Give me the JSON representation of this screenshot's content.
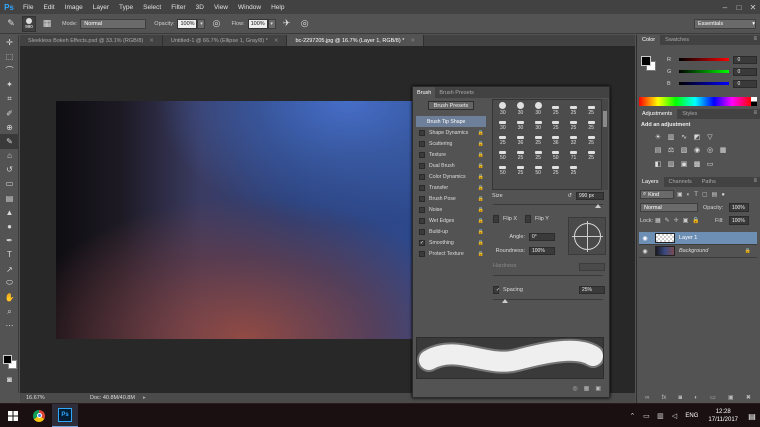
{
  "app": {
    "logo": "Ps"
  },
  "menu": [
    "File",
    "Edit",
    "Image",
    "Layer",
    "Type",
    "Select",
    "Filter",
    "3D",
    "View",
    "Window",
    "Help"
  ],
  "window_controls": {
    "minimize": "–",
    "maximize": "□",
    "close": "✕"
  },
  "options": {
    "brush_size": "990",
    "mode_label": "Mode:",
    "mode_value": "Normal",
    "opacity_label": "Opacity:",
    "opacity_value": "100%",
    "flow_label": "Flow:",
    "flow_value": "100%",
    "workspace": "Essentials"
  },
  "doc_tabs": [
    {
      "label": "Sleekless Bokeh Effects.psd @ 33.1% (RGB/8)",
      "active": false
    },
    {
      "label": "Untitled-1 @ 66.7% (Ellipse 1, Gray/8) *",
      "active": false
    },
    {
      "label": "bc-2297205.jpg @ 16.7% (Layer 1, RGB/8) *",
      "active": true
    }
  ],
  "status": {
    "zoom": "16.67%",
    "doc": "Doc: 40.8M/40.8M"
  },
  "brush_panel": {
    "tabs": [
      "Brush",
      "Brush Presets"
    ],
    "presets_button": "Brush Presets",
    "options": [
      {
        "label": "Brush Tip Shape",
        "checked": null,
        "selected": true
      },
      {
        "label": "Shape Dynamics",
        "checked": false
      },
      {
        "label": "Scattering",
        "checked": false
      },
      {
        "label": "Texture",
        "checked": false
      },
      {
        "label": "Dual Brush",
        "checked": false
      },
      {
        "label": "Color Dynamics",
        "checked": false
      },
      {
        "label": "Transfer",
        "checked": false
      },
      {
        "label": "Brush Pose",
        "checked": false
      },
      {
        "label": "Noise",
        "checked": false
      },
      {
        "label": "Wet Edges",
        "checked": false
      },
      {
        "label": "Build-up",
        "checked": false
      },
      {
        "label": "Smoothing",
        "checked": true
      },
      {
        "label": "Protect Texture",
        "checked": false
      }
    ],
    "tips": [
      "30",
      "30",
      "30",
      "25",
      "25",
      "25",
      "30",
      "30",
      "30",
      "25",
      "25",
      "25",
      "25",
      "36",
      "25",
      "36",
      "32",
      "25",
      "50",
      "25",
      "25",
      "50",
      "71",
      "25",
      "50",
      "25",
      "50",
      "25",
      "25"
    ],
    "size_label": "Size",
    "size_value": "990 px",
    "flip_x": "Flip X",
    "flip_y": "Flip Y",
    "angle_label": "Angle:",
    "angle_value": "0°",
    "roundness_label": "Roundness:",
    "roundness_value": "100%",
    "hardness_label": "Hardness",
    "spacing_label": "Spacing",
    "spacing_value": "25%"
  },
  "color_panel": {
    "tabs": [
      "Color",
      "Swatches"
    ],
    "r_label": "R",
    "r_value": "0",
    "g_label": "G",
    "g_value": "0",
    "b_label": "B",
    "b_value": "0"
  },
  "adjustments_panel": {
    "tabs": [
      "Adjustments",
      "Styles"
    ],
    "heading": "Add an adjustment"
  },
  "layers_panel": {
    "tabs": [
      "Layers",
      "Channels",
      "Paths"
    ],
    "kind": "Kind",
    "blend": "Normal",
    "opacity_label": "Opacity:",
    "opacity_value": "100%",
    "lock_label": "Lock:",
    "fill_label": "Fill:",
    "fill_value": "100%",
    "layers": [
      {
        "name": "Layer 1",
        "selected": true
      },
      {
        "name": "Background",
        "selected": false
      }
    ]
  },
  "taskbar": {
    "lang": "ENG",
    "time": "12:28",
    "date": "17/11/2017"
  }
}
